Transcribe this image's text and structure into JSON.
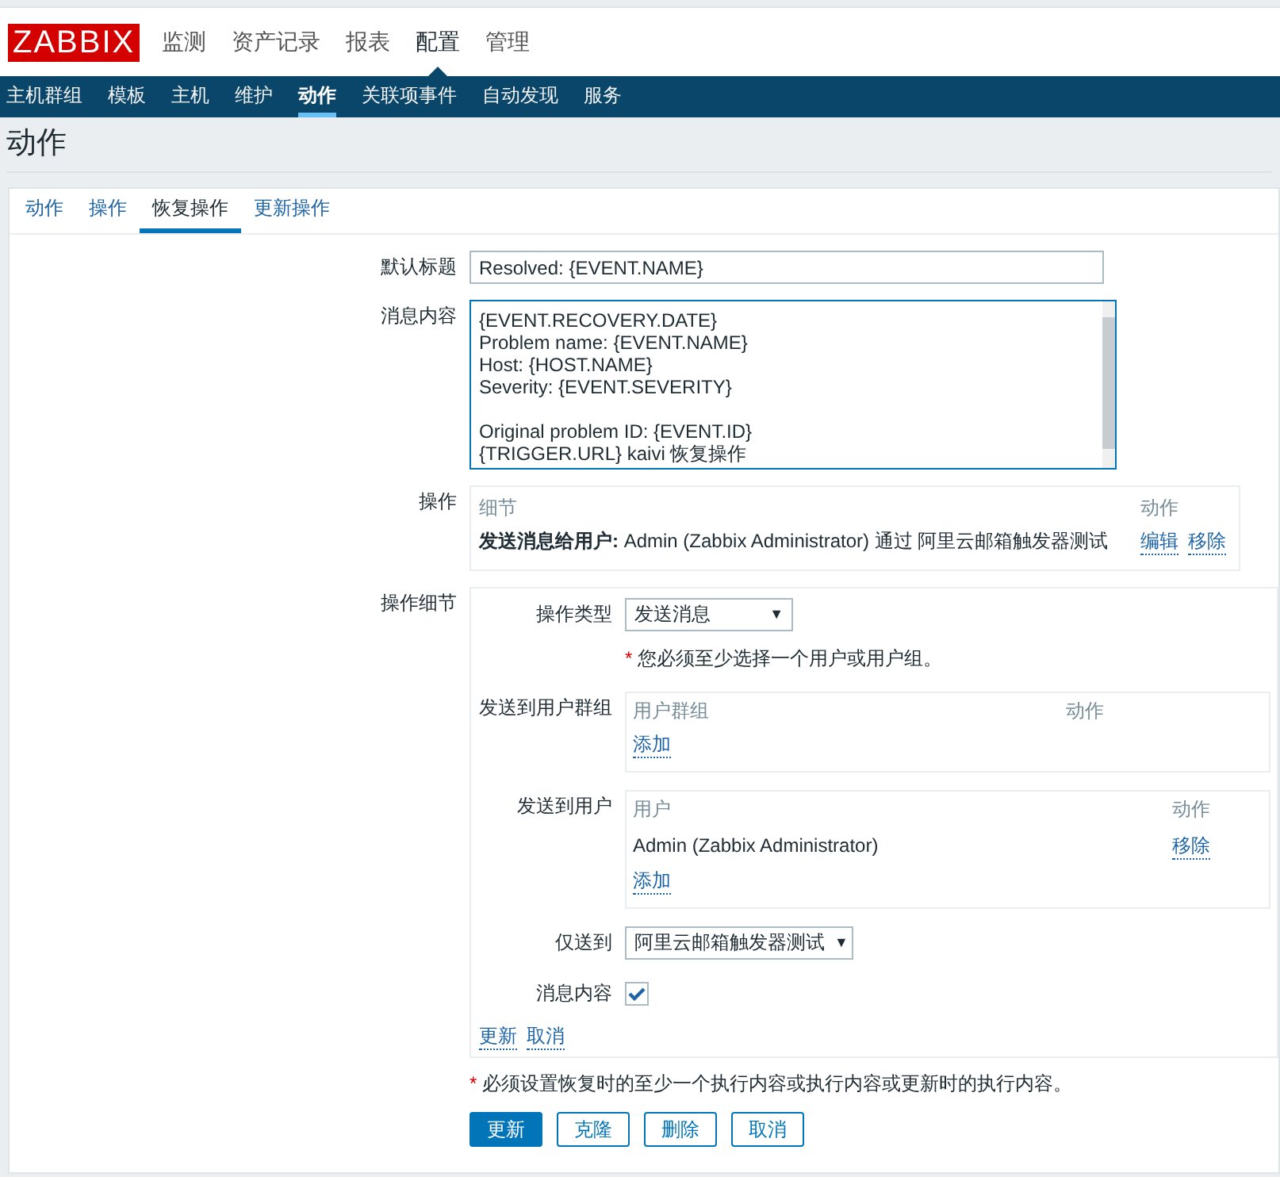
{
  "logo": "ZABBIX",
  "top_menu": [
    {
      "label": "监测",
      "selected": false
    },
    {
      "label": "资产记录",
      "selected": false
    },
    {
      "label": "报表",
      "selected": false
    },
    {
      "label": "配置",
      "selected": true
    },
    {
      "label": "管理",
      "selected": false
    }
  ],
  "sub_menu": [
    {
      "label": "主机群组",
      "selected": false
    },
    {
      "label": "模板",
      "selected": false
    },
    {
      "label": "主机",
      "selected": false
    },
    {
      "label": "维护",
      "selected": false
    },
    {
      "label": "动作",
      "selected": true
    },
    {
      "label": "关联项事件",
      "selected": false
    },
    {
      "label": "自动发现",
      "selected": false
    },
    {
      "label": "服务",
      "selected": false
    }
  ],
  "page_title": "动作",
  "tabs": [
    {
      "label": "动作",
      "selected": false
    },
    {
      "label": "操作",
      "selected": false
    },
    {
      "label": "恢复操作",
      "selected": true
    },
    {
      "label": "更新操作",
      "selected": false
    }
  ],
  "form": {
    "default_subject": {
      "label": "默认标题",
      "value": "Resolved: {EVENT.NAME}"
    },
    "message": {
      "label": "消息内容",
      "paragraphs": [
        [
          "{EVENT.RECOVERY.DATE}",
          "Problem name: {EVENT.NAME}",
          "Host: {HOST.NAME}",
          "Severity: {EVENT.SEVERITY}"
        ],
        [
          "Original problem ID: {EVENT.ID}",
          "{TRIGGER.URL} kaivi 恢复操作"
        ]
      ]
    },
    "operations": {
      "label": "操作",
      "columns": [
        "细节",
        "动作"
      ],
      "rows": [
        {
          "detail": "**发送消息给用户:** Admin (Zabbix Administrator) 通过 阿里云邮箱触发器测试",
          "actions": [
            "编辑",
            "移除"
          ]
        }
      ]
    },
    "operation_details": {
      "label": "操作细节",
      "operation_type": {
        "label": "操作类型",
        "value": "发送消息",
        "caret": "▼"
      },
      "required_mark": "*",
      "note": "您必须至少选择一个用户或用户组。",
      "user_groups": {
        "label": "发送到用户群组",
        "columns": [
          "用户群组",
          "动作"
        ],
        "add": "添加"
      },
      "users": {
        "label": "发送到用户",
        "columns": [
          "用户",
          "动作"
        ],
        "rows": [
          {
            "name": "Admin (Zabbix Administrator)",
            "action": "移除"
          }
        ],
        "add": "添加"
      },
      "send_only_to": {
        "label": "仅送到",
        "value": "阿里云邮箱触发器测试",
        "caret": "▼"
      },
      "default_message": {
        "label": "消息内容",
        "checked": true
      },
      "links": [
        "更新",
        "取消"
      ]
    },
    "required_mark": "*",
    "note": "必须设置恢复时的至少一个执行内容或执行内容或更新时的执行内容。",
    "buttons": [
      {
        "label": "更新",
        "primary": true
      },
      {
        "label": "克隆",
        "primary": false
      },
      {
        "label": "删除",
        "primary": false
      },
      {
        "label": "取消",
        "primary": false
      }
    ]
  }
}
